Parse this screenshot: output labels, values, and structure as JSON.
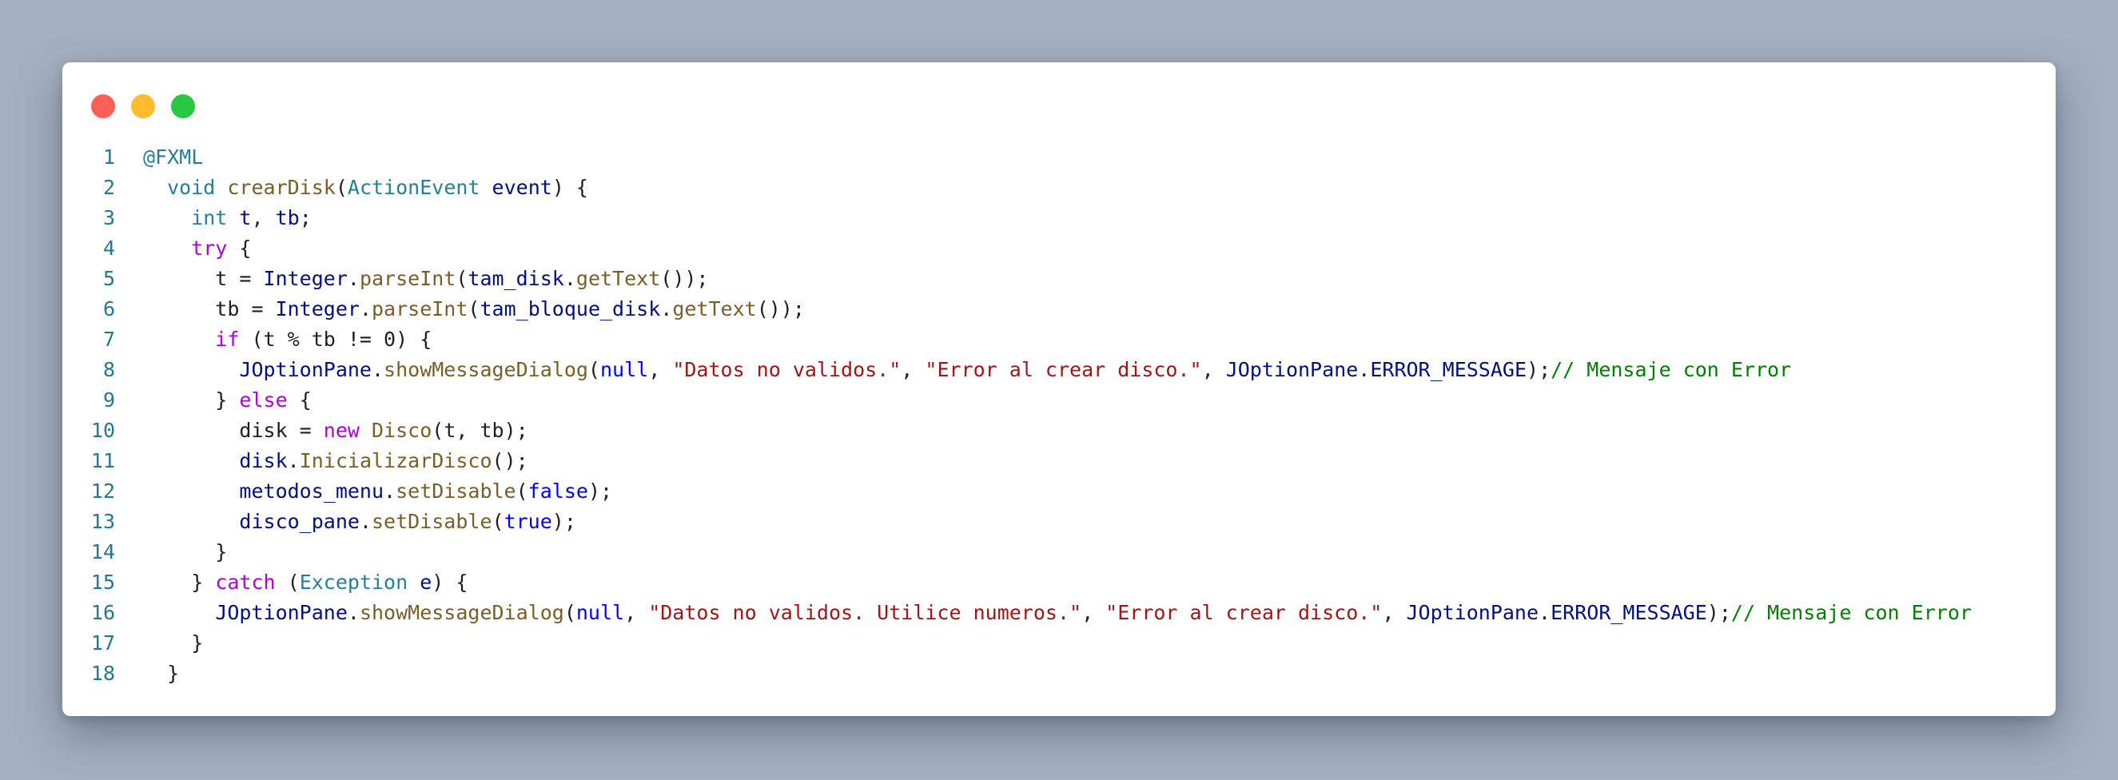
{
  "window": {
    "controls": [
      "close",
      "minimize",
      "maximize"
    ]
  },
  "colors": {
    "background": "#a4b0bf",
    "window": "#ffffff",
    "close": "#ff5f57",
    "minimize": "#febc2e",
    "maximize": "#28c840",
    "keyword": "#0000ff",
    "type": "#267f99",
    "function": "#795e26",
    "variable": "#001080",
    "control": "#af00db",
    "string": "#a31515",
    "comment": "#008000",
    "line_number": "#237893"
  },
  "code": {
    "lines": [
      {
        "n": "1",
        "tokens": [
          {
            "t": "@FXML",
            "c": "ann"
          }
        ]
      },
      {
        "n": "2",
        "tokens": [
          {
            "t": "  void",
            "c": "ty"
          },
          {
            "t": " ",
            "c": "pl"
          },
          {
            "t": "crearDisk",
            "c": "fn"
          },
          {
            "t": "(",
            "c": "pl"
          },
          {
            "t": "ActionEvent",
            "c": "ty"
          },
          {
            "t": " ",
            "c": "pl"
          },
          {
            "t": "event",
            "c": "va"
          },
          {
            "t": ") {",
            "c": "pl"
          }
        ]
      },
      {
        "n": "3",
        "tokens": [
          {
            "t": "    int",
            "c": "ty"
          },
          {
            "t": " ",
            "c": "pl"
          },
          {
            "t": "t",
            "c": "va"
          },
          {
            "t": ", ",
            "c": "pl"
          },
          {
            "t": "tb",
            "c": "va"
          },
          {
            "t": ";",
            "c": "pl"
          }
        ]
      },
      {
        "n": "4",
        "tokens": [
          {
            "t": "    try",
            "c": "ctl"
          },
          {
            "t": " {",
            "c": "pl"
          }
        ]
      },
      {
        "n": "5",
        "tokens": [
          {
            "t": "      t = ",
            "c": "pl"
          },
          {
            "t": "Integer",
            "c": "va"
          },
          {
            "t": ".",
            "c": "pl"
          },
          {
            "t": "parseInt",
            "c": "fn"
          },
          {
            "t": "(",
            "c": "pl"
          },
          {
            "t": "tam_disk",
            "c": "va"
          },
          {
            "t": ".",
            "c": "pl"
          },
          {
            "t": "getText",
            "c": "fn"
          },
          {
            "t": "());",
            "c": "pl"
          }
        ]
      },
      {
        "n": "6",
        "tokens": [
          {
            "t": "      tb = ",
            "c": "pl"
          },
          {
            "t": "Integer",
            "c": "va"
          },
          {
            "t": ".",
            "c": "pl"
          },
          {
            "t": "parseInt",
            "c": "fn"
          },
          {
            "t": "(",
            "c": "pl"
          },
          {
            "t": "tam_bloque_disk",
            "c": "va"
          },
          {
            "t": ".",
            "c": "pl"
          },
          {
            "t": "getText",
            "c": "fn"
          },
          {
            "t": "());",
            "c": "pl"
          }
        ]
      },
      {
        "n": "7",
        "tokens": [
          {
            "t": "      if",
            "c": "ctl"
          },
          {
            "t": " (t % tb != 0) {",
            "c": "pl"
          }
        ]
      },
      {
        "n": "8",
        "tokens": [
          {
            "t": "        JOptionPane",
            "c": "va"
          },
          {
            "t": ".",
            "c": "pl"
          },
          {
            "t": "showMessageDialog",
            "c": "fn"
          },
          {
            "t": "(",
            "c": "pl"
          },
          {
            "t": "null",
            "c": "kw"
          },
          {
            "t": ", ",
            "c": "pl"
          },
          {
            "t": "\"Datos no validos.\"",
            "c": "st"
          },
          {
            "t": ", ",
            "c": "pl"
          },
          {
            "t": "\"Error al crear disco.\"",
            "c": "st"
          },
          {
            "t": ", ",
            "c": "pl"
          },
          {
            "t": "JOptionPane",
            "c": "va"
          },
          {
            "t": ".",
            "c": "pl"
          },
          {
            "t": "ERROR_MESSAGE",
            "c": "va"
          },
          {
            "t": ");",
            "c": "pl"
          },
          {
            "t": "// Mensaje con Error",
            "c": "cm"
          }
        ]
      },
      {
        "n": "9",
        "tokens": [
          {
            "t": "      } ",
            "c": "pl"
          },
          {
            "t": "else",
            "c": "ctl"
          },
          {
            "t": " {",
            "c": "pl"
          }
        ]
      },
      {
        "n": "10",
        "tokens": [
          {
            "t": "        disk = ",
            "c": "pl"
          },
          {
            "t": "new",
            "c": "ctl"
          },
          {
            "t": " ",
            "c": "pl"
          },
          {
            "t": "Disco",
            "c": "fn"
          },
          {
            "t": "(t, tb);",
            "c": "pl"
          }
        ]
      },
      {
        "n": "11",
        "tokens": [
          {
            "t": "        disk",
            "c": "va"
          },
          {
            "t": ".",
            "c": "pl"
          },
          {
            "t": "InicializarDisco",
            "c": "fn"
          },
          {
            "t": "();",
            "c": "pl"
          }
        ]
      },
      {
        "n": "12",
        "tokens": [
          {
            "t": "        metodos_menu",
            "c": "va"
          },
          {
            "t": ".",
            "c": "pl"
          },
          {
            "t": "setDisable",
            "c": "fn"
          },
          {
            "t": "(",
            "c": "pl"
          },
          {
            "t": "false",
            "c": "kw"
          },
          {
            "t": ");",
            "c": "pl"
          }
        ]
      },
      {
        "n": "13",
        "tokens": [
          {
            "t": "        disco_pane",
            "c": "va"
          },
          {
            "t": ".",
            "c": "pl"
          },
          {
            "t": "setDisable",
            "c": "fn"
          },
          {
            "t": "(",
            "c": "pl"
          },
          {
            "t": "true",
            "c": "kw"
          },
          {
            "t": ");",
            "c": "pl"
          }
        ]
      },
      {
        "n": "14",
        "tokens": [
          {
            "t": "      }",
            "c": "pl"
          }
        ]
      },
      {
        "n": "15",
        "tokens": [
          {
            "t": "    } ",
            "c": "pl"
          },
          {
            "t": "catch",
            "c": "ctl"
          },
          {
            "t": " (",
            "c": "pl"
          },
          {
            "t": "Exception",
            "c": "ty"
          },
          {
            "t": " ",
            "c": "pl"
          },
          {
            "t": "e",
            "c": "va"
          },
          {
            "t": ") {",
            "c": "pl"
          }
        ]
      },
      {
        "n": "16",
        "tokens": [
          {
            "t": "      JOptionPane",
            "c": "va"
          },
          {
            "t": ".",
            "c": "pl"
          },
          {
            "t": "showMessageDialog",
            "c": "fn"
          },
          {
            "t": "(",
            "c": "pl"
          },
          {
            "t": "null",
            "c": "kw"
          },
          {
            "t": ", ",
            "c": "pl"
          },
          {
            "t": "\"Datos no validos. Utilice numeros.\"",
            "c": "st"
          },
          {
            "t": ", ",
            "c": "pl"
          },
          {
            "t": "\"Error al crear disco.\"",
            "c": "st"
          },
          {
            "t": ", ",
            "c": "pl"
          },
          {
            "t": "JOptionPane",
            "c": "va"
          },
          {
            "t": ".",
            "c": "pl"
          },
          {
            "t": "ERROR_MESSAGE",
            "c": "va"
          },
          {
            "t": ");",
            "c": "pl"
          },
          {
            "t": "// Mensaje con Error",
            "c": "cm"
          }
        ]
      },
      {
        "n": "17",
        "tokens": [
          {
            "t": "    }",
            "c": "pl"
          }
        ]
      },
      {
        "n": "18",
        "tokens": [
          {
            "t": "  }",
            "c": "pl"
          }
        ]
      }
    ]
  }
}
